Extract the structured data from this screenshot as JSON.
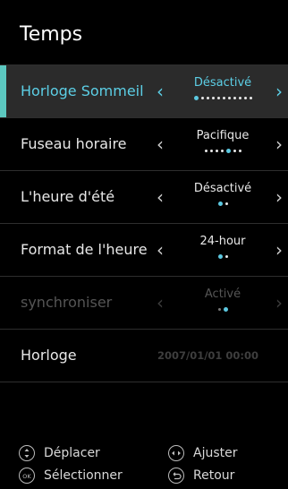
{
  "header": {
    "title": "Temps"
  },
  "settings": [
    {
      "label": "Horloge Sommeil",
      "value": "Désactivé",
      "state": "active"
    },
    {
      "label": "Fuseau horaire",
      "value": "Pacifique",
      "state": "normal"
    },
    {
      "label": "L'heure d'été",
      "value": "Désactivé",
      "state": "normal"
    },
    {
      "label": "Format de l'heure",
      "value": "24-hour",
      "state": "normal"
    },
    {
      "label": "synchroniser",
      "value": "Activé",
      "state": "disabled"
    },
    {
      "label": "Horloge",
      "value": "2007/01/01 00:00",
      "state": "normal"
    }
  ],
  "footer": {
    "move_label": "Déplacer",
    "adjust_label": "Ajuster",
    "select_label": "Sélectionner",
    "back_label": "Retour"
  },
  "colors": {
    "accent": "#5cc8c0",
    "highlight_text": "#5ccfe6",
    "background": "#000000"
  }
}
